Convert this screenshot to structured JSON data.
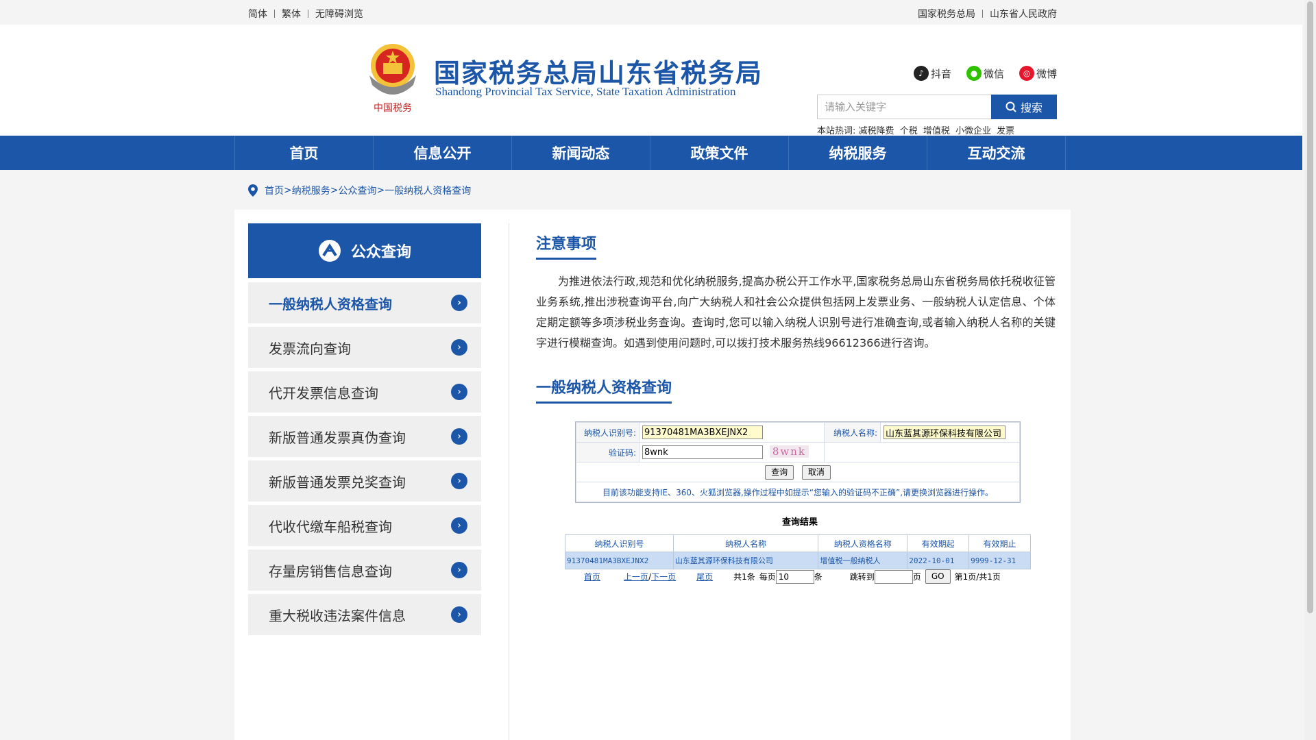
{
  "topbar": {
    "left_links": [
      "简体",
      "繁体",
      "无障碍浏览"
    ],
    "right_links": [
      "国家税务总局",
      "山东省人民政府"
    ]
  },
  "header": {
    "title": "国家税务总局山东省税务局",
    "subtitle": "Shandong Provincial Tax Service, State Taxation Administration",
    "logo_text": "中国税务",
    "social": [
      {
        "label": "抖音",
        "icon": "tiktok-icon",
        "color": "#222222"
      },
      {
        "label": "微信",
        "icon": "wechat-icon",
        "color": "#2dc100"
      },
      {
        "label": "微博",
        "icon": "weibo-icon",
        "color": "#e6162d"
      }
    ],
    "search_placeholder": "请输入关键字",
    "search_button": "搜索",
    "hot_label": "本站热词:",
    "hot_words": [
      "减税降费",
      "个税",
      "增值税",
      "小微企业",
      "发票"
    ]
  },
  "nav": [
    "首页",
    "信息公开",
    "新闻动态",
    "政策文件",
    "纳税服务",
    "互动交流"
  ],
  "breadcrumb": [
    "首页",
    "纳税服务",
    "公众查询",
    "一般纳税人资格查询"
  ],
  "sidebar": {
    "title": "公众查询",
    "items": [
      "一般纳税人资格查询",
      "发票流向查询",
      "代开发票信息查询",
      "新版普通发票真伪查询",
      "新版普通发票兑奖查询",
      "代收代缴车船税查询",
      "存量房销售信息查询",
      "重大税收违法案件信息"
    ]
  },
  "content": {
    "notice_title": "注意事项",
    "notice_text": "为推进依法行政,规范和优化纳税服务,提高办税公开工作水平,国家税务总局山东省税务局依托税收征管业务系统,推出涉税查询平台,向广大纳税人和社会公众提供包括网上发票业务、一般纳税人认定信息、个体定期定额等多项涉税业务查询。查询时,您可以输入纳税人识别号进行准确查询,或者输入纳税人名称的关键字进行模糊查询。如遇到使用问题时,可以拨打技术服务热线96612366进行咨询。",
    "query_title": "一般纳税人资格查询",
    "form": {
      "id_label": "纳税人识别号:",
      "id_value": "91370481MA3BXEJNX2",
      "name_label": "纳税人名称:",
      "name_value": "山东蓝其源环保科技有限公司",
      "captcha_label": "验证码:",
      "captcha_value": "8wnk",
      "captcha_image_text": "8wnk",
      "query_button": "查询",
      "cancel_button": "取消",
      "tip": "目前该功能支持IE、360、火狐浏览器,操作过程中如提示“您输入的验证码不正确”,请更换浏览器进行操作。"
    },
    "result_title": "查询结果",
    "result_headers": [
      "纳税人识别号",
      "纳税人名称",
      "纳税人资格名称",
      "有效期起",
      "有效期止"
    ],
    "result_rows": [
      [
        "91370481MA3BXEJNX2",
        "山东蓝其源环保科技有限公司",
        "增值税一般纳税人",
        "2022-10-01",
        "9999-12-31"
      ]
    ],
    "pager": {
      "first": "首页",
      "prev": "上一页",
      "slash": "/",
      "next": "下一页",
      "last": "尾页",
      "total": "共1条",
      "per_page_label": "每页",
      "per_page_value": "10",
      "per_page_unit": "条",
      "jump_label": "跳转到",
      "jump_value": "",
      "page_unit": "页",
      "go": "GO",
      "page_status": "第1页/共1页"
    }
  }
}
